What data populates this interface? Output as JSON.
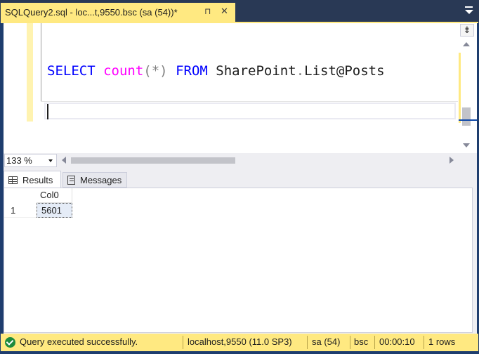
{
  "tab": {
    "title": "SQLQuery2.sql - loc...t,9550.bsc (sa (54))*",
    "pin_glyph": "⊓",
    "close_glyph": "✕"
  },
  "editor": {
    "tokens": [
      {
        "text": "SELECT",
        "kind": "keyword"
      },
      {
        "text": " ",
        "kind": "space"
      },
      {
        "text": "count",
        "kind": "function"
      },
      {
        "text": "(*)",
        "kind": "operator"
      },
      {
        "text": " ",
        "kind": "space"
      },
      {
        "text": "FROM",
        "kind": "keyword"
      },
      {
        "text": " ",
        "kind": "space"
      },
      {
        "text": "SharePoint",
        "kind": "identifier"
      },
      {
        "text": ".",
        "kind": "operator"
      },
      {
        "text": "List@Posts",
        "kind": "identifier"
      }
    ],
    "split_glyph": "⇟"
  },
  "zoom": {
    "value": "133 %"
  },
  "results_tabs": {
    "results": "Results",
    "messages": "Messages"
  },
  "grid": {
    "columns": [
      "Col0"
    ],
    "rows": [
      {
        "num": "1",
        "cells": [
          "5601"
        ]
      }
    ]
  },
  "status": {
    "message": "Query executed successfully.",
    "server": "localhost,9550 (11.0 SP3)",
    "user": "sa (54)",
    "database": "bsc",
    "elapsed": "00:00:10",
    "rows": "1 rows"
  },
  "colors": {
    "accent_yellow": "#ffe981",
    "keyword": "#0000ff",
    "function": "#ff00ff",
    "operator": "#808080",
    "success": "#1e8b3c"
  }
}
